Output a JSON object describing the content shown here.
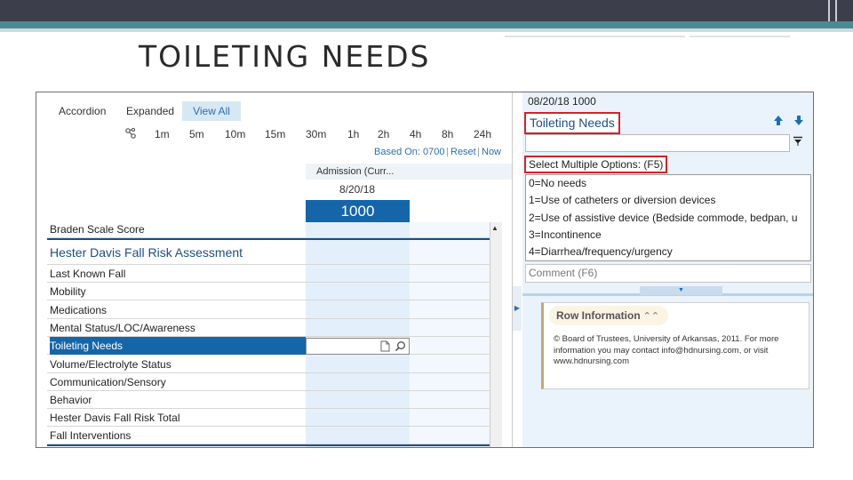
{
  "slide": {
    "title": "TOILETING NEEDS",
    "colors": {
      "dark_bar": "#3c3f4b",
      "teal_bar": "#4a8b93",
      "accent_blue": "#1466a8",
      "highlight_red": "#d2232a"
    }
  },
  "flowsheet": {
    "view_tabs": [
      {
        "label": "Accordion",
        "active": false
      },
      {
        "label": "Expanded",
        "active": false
      },
      {
        "label": "View All",
        "active": true
      }
    ],
    "interval_icon": "link-icon",
    "intervals": [
      "1m",
      "5m",
      "10m",
      "15m",
      "30m",
      "1h",
      "2h",
      "4h",
      "8h",
      "24h"
    ],
    "based_on": "Based On: 0700",
    "reset": "Reset",
    "now": "Now",
    "column_header": "Admission (Curr...",
    "column_date": "8/20/18",
    "column_time": "1000",
    "rows": [
      {
        "label": "Braden Scale Score"
      },
      {
        "label": "Hester Davis Fall Risk Assessment",
        "section": true
      },
      {
        "label": "Last Known Fall"
      },
      {
        "label": "Mobility"
      },
      {
        "label": "Medications"
      },
      {
        "label": "Mental Status/LOC/Awareness"
      },
      {
        "label": "Toileting Needs",
        "selected": true
      },
      {
        "label": "Volume/Electrolyte Status"
      },
      {
        "label": "Communication/Sensory"
      },
      {
        "label": "Behavior"
      },
      {
        "label": "Hester Davis Fall Risk Total"
      },
      {
        "label": "Fall Interventions"
      }
    ]
  },
  "detail": {
    "datetime": "08/20/18 1000",
    "title": "Toileting Needs",
    "select_label": "Select Multiple Options: (F5)",
    "options": [
      "0=No needs",
      "1=Use of catheters or diversion devices",
      "2=Use of assistive device (Bedside commode, bedpan, u",
      "3=Incontinence",
      "4=Diarrhea/frequency/urgency"
    ],
    "comment_placeholder": "Comment (F6)",
    "row_info": {
      "title": "Row Information",
      "text": "© Board of Trustees, University of Arkansas, 2011. For more information you may contact info@hdnursing.com, or visit www.hdnursing.com"
    }
  }
}
